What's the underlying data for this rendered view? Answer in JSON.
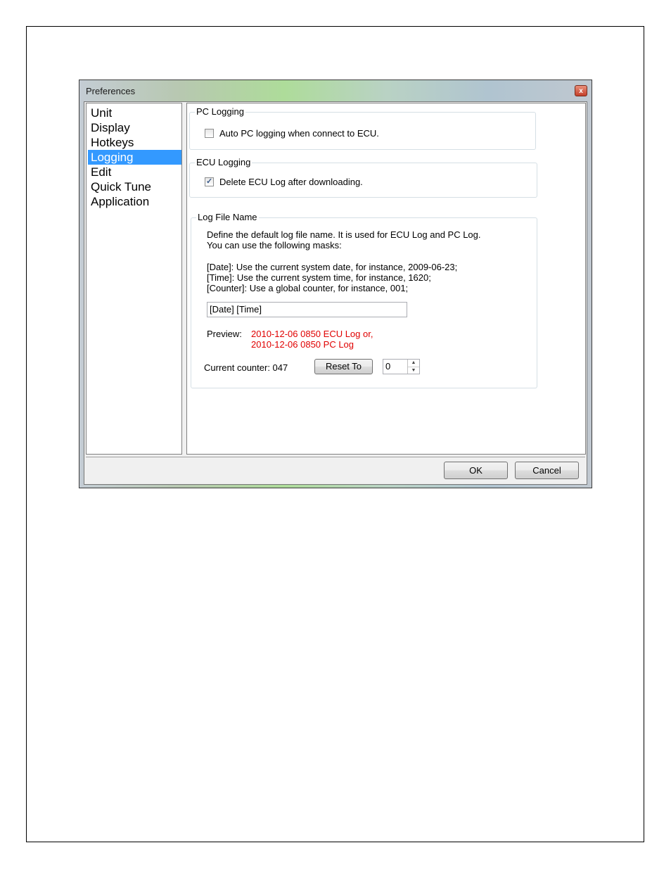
{
  "window": {
    "title": "Preferences",
    "close_glyph": "x"
  },
  "nav": {
    "items": [
      {
        "label": "Unit",
        "selected": false
      },
      {
        "label": "Display",
        "selected": false
      },
      {
        "label": "Hotkeys",
        "selected": false
      },
      {
        "label": "Logging",
        "selected": true
      },
      {
        "label": "Edit",
        "selected": false
      },
      {
        "label": "Quick Tune",
        "selected": false
      },
      {
        "label": "Application",
        "selected": false
      }
    ]
  },
  "pc_logging": {
    "title": "PC Logging",
    "auto_label": "Auto PC logging when connect to ECU.",
    "auto_checked": false
  },
  "ecu_logging": {
    "title": "ECU Logging",
    "delete_label": "Delete ECU Log after downloading.",
    "delete_checked": true
  },
  "log_file": {
    "title": "Log File Name",
    "desc_line1": "Define the default log file name. It is used for ECU Log and PC Log.",
    "desc_line2": "You can use the following masks:",
    "mask_date": "[Date]: Use the current system date, for instance, 2009-06-23;",
    "mask_time": "[Time]: Use the current system time, for instance, 1620;",
    "mask_counter": "[Counter]: Use a global counter, for instance, 001;",
    "name_value": "[Date] [Time]",
    "preview_label": "Preview:",
    "preview_line1": "2010-12-06 0850 ECU Log or,",
    "preview_line2": "2010-12-06 0850 PC Log",
    "counter_label": "Current counter: 047",
    "reset_label": "Reset To",
    "reset_value": "0",
    "preview_color": "#e00000"
  },
  "footer": {
    "ok_label": "OK",
    "cancel_label": "Cancel"
  }
}
